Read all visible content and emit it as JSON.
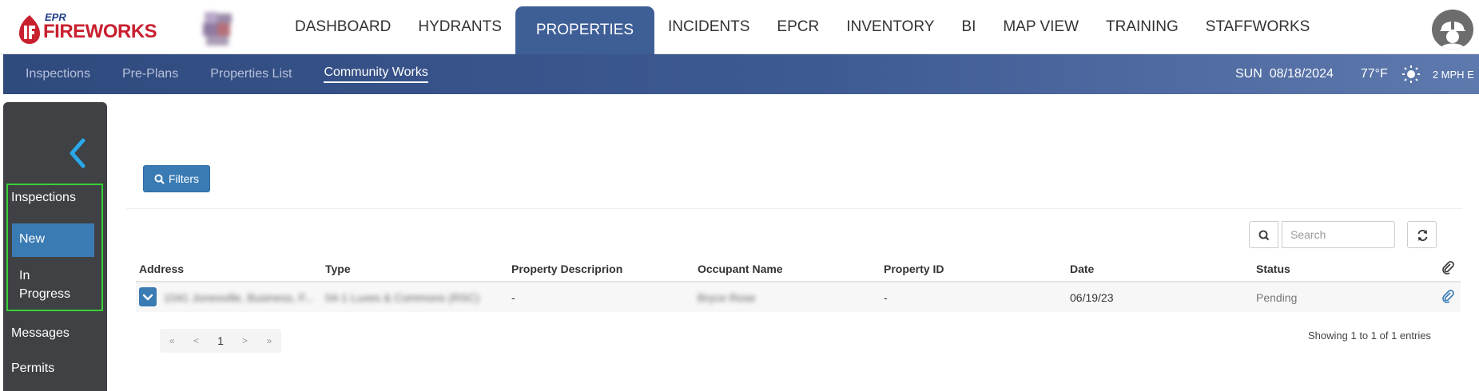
{
  "brand": {
    "top": "EPR",
    "name": "FIREWORKS"
  },
  "main_nav": [
    {
      "label": "DASHBOARD"
    },
    {
      "label": "HYDRANTS"
    },
    {
      "label": "PROPERTIES",
      "active": true
    },
    {
      "label": "INCIDENTS"
    },
    {
      "label": "EPCR"
    },
    {
      "label": "INVENTORY"
    },
    {
      "label": "BI"
    },
    {
      "label": "MAP VIEW"
    },
    {
      "label": "TRAINING"
    },
    {
      "label": "STAFFWORKS"
    }
  ],
  "sub_nav": [
    {
      "label": "Inspections"
    },
    {
      "label": "Pre-Plans"
    },
    {
      "label": "Properties List"
    },
    {
      "label": "Community Works",
      "active": true
    }
  ],
  "weather": {
    "day": "SUN",
    "date": "08/18/2024",
    "temp": "77°F",
    "icon": "sun-icon",
    "wind": "2 MPH E"
  },
  "sidebar": {
    "group_label": "Inspections",
    "items": [
      {
        "label": "New",
        "active": true
      },
      {
        "label": "In Progress"
      }
    ],
    "messages": "Messages",
    "permits": "Permits"
  },
  "toolbar": {
    "filters_label": "Filters",
    "search_placeholder": "Search"
  },
  "table": {
    "columns": [
      "Address",
      "Type",
      "Property Descriprion",
      "Occupant Name",
      "Property ID",
      "Date",
      "Status"
    ],
    "rows": [
      {
        "address": "1041 Jonesville, Business, F...",
        "type": "04-1 Luxes & Commons (RSC)",
        "description": "-",
        "occupant": "Bryce Rose",
        "property_id": "-",
        "date": "06/19/23",
        "status": "Pending"
      }
    ]
  },
  "pagination": {
    "first": "«",
    "prev": "<",
    "current": "1",
    "next": ">",
    "last": "»"
  },
  "summary": "Showing 1 to 1 of 1 entries",
  "colors": {
    "nav_active": "#3e5e96",
    "primary_button": "#3a7bb4",
    "sidebar": "#3f4144",
    "highlight_box": "#35d235",
    "brand_red": "#c8202f"
  }
}
